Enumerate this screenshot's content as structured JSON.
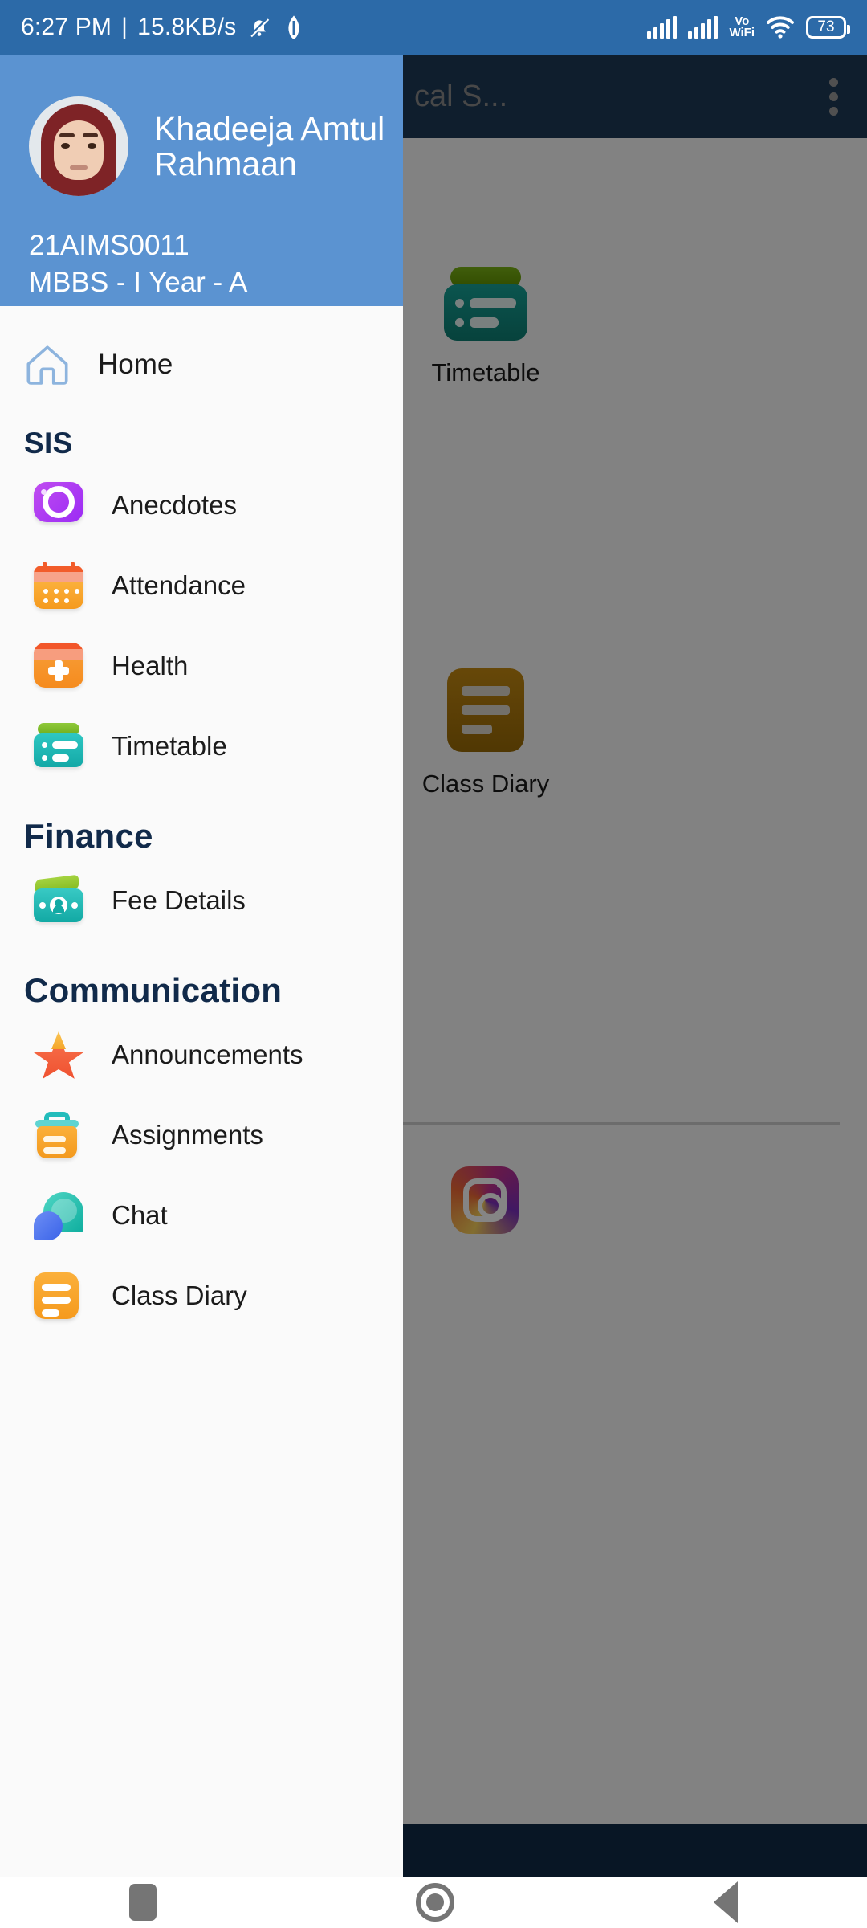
{
  "status_bar": {
    "time": "6:27 PM",
    "separator": "|",
    "network_speed": "15.8KB/s",
    "mute_icon": "bell-muted-icon",
    "data_saver_icon": "data-saver-icon",
    "signal_1_icon": "signal-bars-icon",
    "signal_2_icon": "signal-bars-icon",
    "volte_line1": "Vo",
    "volte_line2": "WiFi",
    "wifi_icon": "wifi-icon",
    "battery_level": "73"
  },
  "background_app": {
    "title": "cal S...",
    "overflow_icon": "kebab-menu-icon",
    "grid_items": [
      {
        "label": "Timetable",
        "icon": "timetable-icon"
      },
      {
        "label": "Class Diary",
        "icon": "class-diary-icon"
      }
    ],
    "social_icon": "instagram-icon"
  },
  "drawer": {
    "profile": {
      "avatar": "student-avatar",
      "name": "Khadeeja Amtul Rahmaan",
      "name_line1": "Khadeeja Amtul",
      "name_line2": "Rahmaan",
      "student_id": "21AIMS0011",
      "class_info": "MBBS - I Year - A"
    },
    "home": {
      "label": "Home",
      "icon": "home-icon"
    },
    "sections": [
      {
        "title": "SIS",
        "items": [
          {
            "label": "Anecdotes",
            "icon": "camera-icon"
          },
          {
            "label": "Attendance",
            "icon": "calendar-icon"
          },
          {
            "label": "Health",
            "icon": "medical-cross-icon"
          },
          {
            "label": "Timetable",
            "icon": "timetable-icon"
          }
        ]
      },
      {
        "title": "Finance",
        "items": [
          {
            "label": "Fee Details",
            "icon": "money-icon"
          }
        ]
      },
      {
        "title": "Communication",
        "items": [
          {
            "label": "Announcements",
            "icon": "star-icon"
          },
          {
            "label": "Assignments",
            "icon": "clipboard-icon"
          },
          {
            "label": "Chat",
            "icon": "chat-bubbles-icon"
          },
          {
            "label": "Class Diary",
            "icon": "class-diary-icon"
          }
        ]
      }
    ]
  },
  "nav_bar": {
    "recent_label": "recent-apps-button",
    "home_label": "home-button",
    "back_label": "back-button"
  },
  "colors": {
    "status_bar": "#2c6aa8",
    "drawer_header": "#5b93d1",
    "app_bar": "#1e3a57",
    "section_title": "#112a4a",
    "drawer_bg": "#fafafa"
  }
}
